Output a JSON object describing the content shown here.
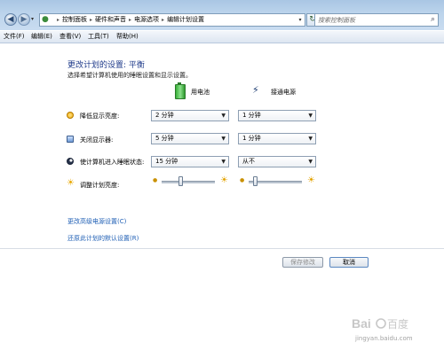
{
  "address_bar": {
    "crumbs": [
      "控制面板",
      "硬件和声音",
      "电源选项",
      "编辑计划设置"
    ],
    "separator": "▸"
  },
  "search": {
    "placeholder": "搜索控制面板"
  },
  "menu": [
    "文件(F)",
    "编辑(E)",
    "查看(V)",
    "工具(T)",
    "帮助(H)"
  ],
  "page": {
    "title": "更改计划的设置: 平衡",
    "subtitle": "选择希望计算机使用的睡眠设置和显示设置。"
  },
  "columns": {
    "battery": "用电池",
    "plugged": "接通电源"
  },
  "rows": [
    {
      "label": "降低显示亮度:",
      "icon": "dim-display-icon",
      "battery": "2 分钟",
      "plugged": "1 分钟"
    },
    {
      "label": "关闭显示器:",
      "icon": "monitor-icon",
      "battery": "5 分钟",
      "plugged": "1 分钟"
    },
    {
      "label": "使计算机进入睡眠状态:",
      "icon": "sleep-icon",
      "battery": "15 分钟",
      "plugged": "从不"
    }
  ],
  "brightness": {
    "label": "调整计划亮度:",
    "battery_level": 0.35,
    "plugged_level": 0.12
  },
  "links": {
    "advanced": "更改高级电源设置(C)",
    "restore": "还原此计划的默认设置(R)"
  },
  "buttons": {
    "save": "保存修改",
    "cancel": "取消"
  },
  "watermark": {
    "logo_text": "Bai百度",
    "url": "jingyan.baidu.com"
  },
  "colors": {
    "title": "#1e3a8a",
    "link": "#1f5fb5",
    "chrome": "#bcd4ec"
  }
}
